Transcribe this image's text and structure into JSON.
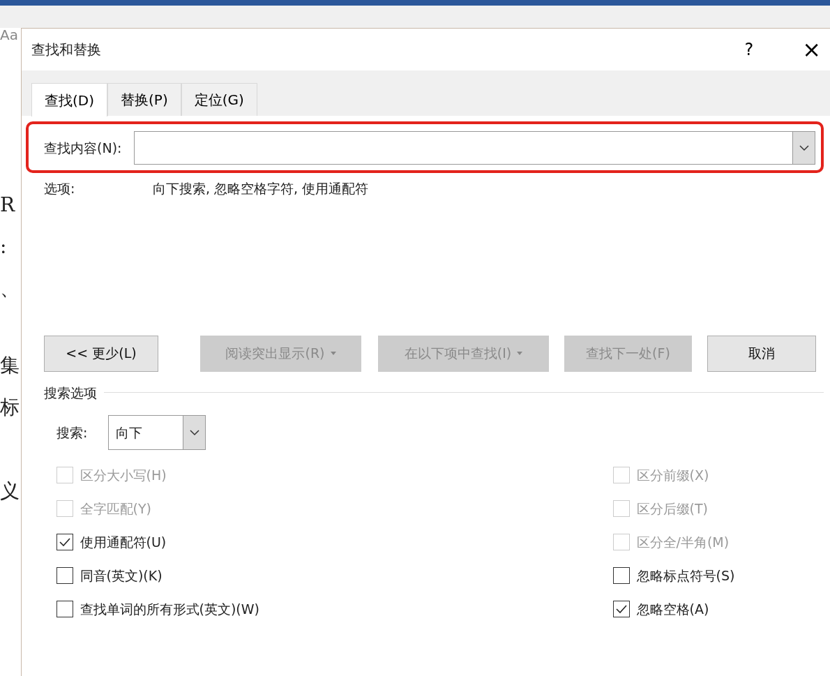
{
  "background": {
    "fragments": [
      "Aa",
      "R",
      ":",
      "、",
      "集",
      "标",
      "义"
    ]
  },
  "window": {
    "title": "查找和替换",
    "help": "?",
    "close": "×"
  },
  "tabs": [
    {
      "label": "查找(D)",
      "selected": true
    },
    {
      "label": "替换(P)",
      "selected": false
    },
    {
      "label": "定位(G)",
      "selected": false
    }
  ],
  "find": {
    "label": "查找内容(N):",
    "highlighted": true
  },
  "options": {
    "label": "选项:",
    "value": "向下搜索, 忽略空格字符, 使用通配符"
  },
  "buttons": [
    {
      "label": "<< 更少(L)",
      "disabled": false,
      "dropdown": false
    },
    {
      "label": "阅读突出显示(R)",
      "disabled": true,
      "dropdown": true
    },
    {
      "label": "在以下项中查找(I)",
      "disabled": true,
      "dropdown": true
    },
    {
      "label": "查找下一处(F)",
      "disabled": true,
      "dropdown": false
    },
    {
      "label": "取消",
      "disabled": false,
      "dropdown": false
    }
  ],
  "search_options": {
    "heading": "搜索选项",
    "direction_label": "搜索:",
    "direction_value": "向下",
    "left": [
      {
        "label": "区分大小写(H)",
        "checked": false,
        "disabled": true
      },
      {
        "label": "全字匹配(Y)",
        "checked": false,
        "disabled": true
      },
      {
        "label": "使用通配符(U)",
        "checked": true,
        "disabled": false
      },
      {
        "label": "同音(英文)(K)",
        "checked": false,
        "disabled": false
      },
      {
        "label": "查找单词的所有形式(英文)(W)",
        "checked": false,
        "disabled": false
      }
    ],
    "right": [
      {
        "label": "区分前缀(X)",
        "checked": false,
        "disabled": true
      },
      {
        "label": "区分后缀(T)",
        "checked": false,
        "disabled": true
      },
      {
        "label": "区分全/半角(M)",
        "checked": false,
        "disabled": true
      },
      {
        "label": "忽略标点符号(S)",
        "checked": false,
        "disabled": false
      },
      {
        "label": "忽略空格(A)",
        "checked": true,
        "disabled": false
      }
    ]
  }
}
